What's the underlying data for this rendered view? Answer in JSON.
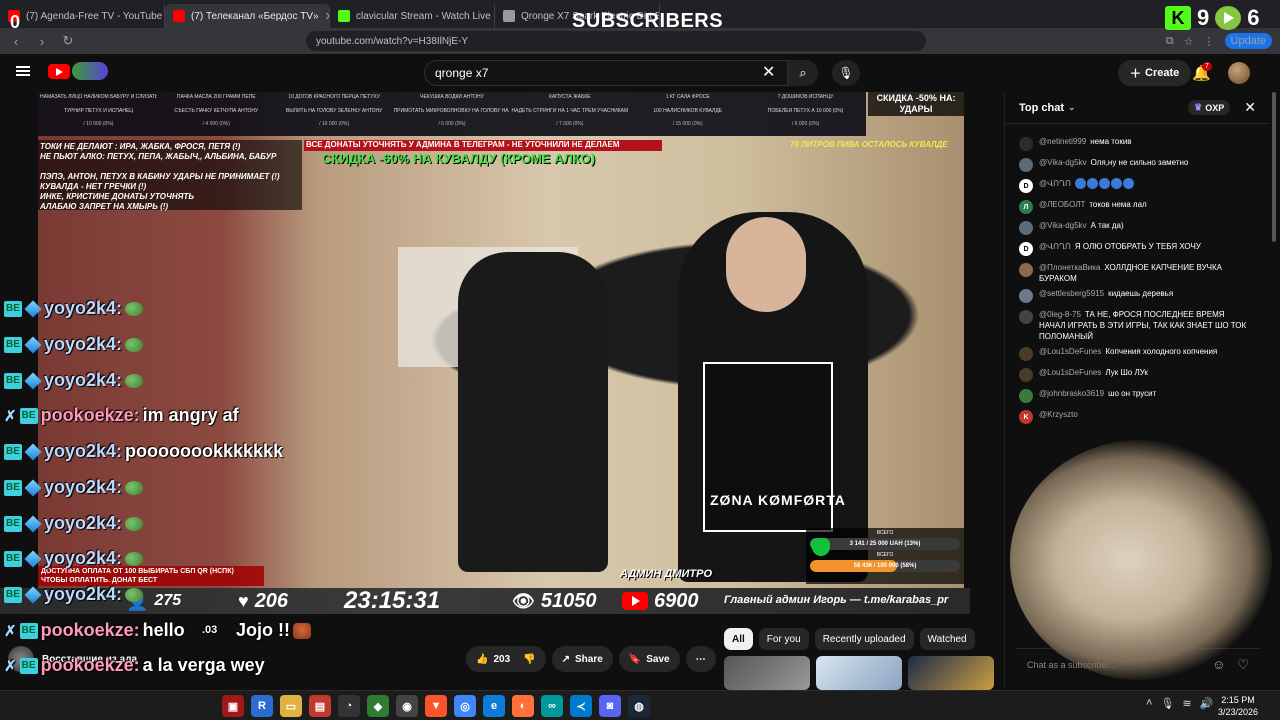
{
  "browser": {
    "tabs": [
      {
        "title": "(7) Agenda-Free TV - YouTube",
        "color": "#ff0000",
        "active": false
      },
      {
        "title": "(7) Телеканал «Бердос TV»",
        "color": "#ff0000",
        "active": true
      },
      {
        "title": "clavicular Stream - Watch Live on Ki",
        "color": "#53fc18",
        "active": false
      },
      {
        "title": "Qronge X7 Spark Electric Dirt Bike |",
        "color": "#999999",
        "active": false
      }
    ],
    "url": "youtube.com/watch?v=H38IlNjE-Y",
    "update_label": "Update"
  },
  "overlay_top": {
    "counter": "0",
    "subscribers_label": "SUBSCRIBERS",
    "kick_count": "9",
    "rumble_count": "6"
  },
  "youtube": {
    "search_query": "qronge x7",
    "create_label": "Create",
    "notifications_count": "7"
  },
  "stream": {
    "donation_items": [
      {
        "label": "НАМАЗАТЬ ЛИЦО НАЛИКОМ БАБУРУ И СЛИЗАТЬ КУВАЛДЕ",
        "price": "/ 10 000 (0%)"
      },
      {
        "label": "ПАЧКА МАСЛА 200 ГРАММ ПЕПЕ",
        "price": "/ 4 000 (0%)"
      },
      {
        "label": "10 ДОГОВ КРАСНОГО ПЕРЦА ПЕТУХУ",
        "price": "/ 10 000 (0%)"
      },
      {
        "label": "ЧЕКУШКА ВОДКИ АНТОНУ",
        "price": "/ 5 000 (0%)"
      },
      {
        "label": "КАПУСТА ЖАБКЕ",
        "price": "/ 7 000 (0%)"
      },
      {
        "label": "1 КГ САЛА ФРОСЕ",
        "price": "/ 15 000 (0%)"
      },
      {
        "label": "7 ДОШИКОВ ИСПАНЦУ",
        "price": "/ 6 000 (0%)"
      },
      {
        "label": "ТУРНИР ПЕТУХ И ИСПАНЕЦ",
        "price": "/ 5 000 (0%)"
      },
      {
        "label": "СЪЕСТЬ ПАЧКУ КЕТЧУПА АНТОНУ",
        "price": "/ 2 000 (0%)"
      },
      {
        "label": "ВЫЛИТЬ НА ГОЛОВУ ЗЕЛЕНКУ АНТОНУ",
        "price": "/ 2 000 (0%)"
      },
      {
        "label": "ПРИМОТАТЬ МИКРОВОЛНОВКУ НА ГОЛОВУ НА 10 МИН КУВАЛДЕ",
        "price": "/ 10 000 (0%)"
      },
      {
        "label": "НАДЕТЬ СТРИНГИ НА 1 ЧАС ТРЕМ УЧАСНИКАМ",
        "price": "/ 6 000 (0%)"
      },
      {
        "label": "100 НАЛИСНИКОВ КУВАЛДЕ",
        "price": "/ 30 000 (0%)"
      },
      {
        "label": "ПОБЕЛЕЙ ПЕТУХ А 10 000 (0%)",
        "price": "/ 2 000 (0%)"
      }
    ],
    "discount_strikes": "СКИДКА -50% НА: УДАРЫ",
    "rules_lines": [
      "ТОКИ НЕ ДЕЛАЮТ : ИРА, ЖАБКА, ФРОСЯ, ПЕТЯ (!)",
      "НЕ ПЬЮТ АЛКО: ПЕТУХ, ПЕПА, ЖАБЫЧ,, АЛЬБИНА, БАБУР",
      "",
      "ПЭПЭ, АНТОН, ПЕТУХ В КАБИНУ УДАРЫ НЕ ПРИНИМАЕТ (!)",
      "КУВАЛДА - НЕТ ГРЕЧКИ (!)",
      "ИНКЕ, КРИСТИНЕ ДОНАТЫ УТОЧНЯТЬ",
      "АЛАБАЮ ЗАПРЕТ НА ХМЫРЬ (!)"
    ],
    "red_banner": "ВСЕ ДОНАТЫ УТОЧНЯТЬ У АДМИНА В ТЕЛЕГРАМ - НЕ УТОЧНИЛИ НЕ ДЕЛАЕМ",
    "green_banner": "СКИДКА -60% НА КУВАЛДУ (КРОМЕ АЛКО)",
    "beer_left": "78 ЛИТРОВ ПИВА ОСТАЛОСЬ КУВАЛДЕ",
    "shirt_brand": "ZØNA KØMFØRTA",
    "admin_label": "АДМИН ДМИТРО",
    "goals": [
      {
        "title": "ВСЕГО",
        "text": "3 141 / 25 000 UAH (13%)",
        "fraction": 0.13,
        "color": "#22b14c"
      },
      {
        "title": "ВСЕГО",
        "text": "58 436 / 100 000 (58%)",
        "fraction": 0.58,
        "color": "#f0932b"
      }
    ],
    "donate_banner": "ДОСТУПНА ОПЛАТА ОТ 100 ВЫБИРАТЬ СБП QR (НСПК) ЧТОБЫ ОПЛАТИТЬ. ДОНАТ БЕСТ",
    "stats": {
      "viewers_small": "275",
      "likes": "206",
      "timer": "23:15:31",
      "views": "51050",
      "yt_subs": "6900",
      "ticker": "Главный админ Игорь — t.me/karabas_pr"
    }
  },
  "overlay_chat": [
    {
      "user": "yoyo2k4:",
      "text": "",
      "style": "blue",
      "emote": "pepe"
    },
    {
      "user": "yoyo2k4:",
      "text": "",
      "style": "blue",
      "emote": "pepe"
    },
    {
      "user": "yoyo2k4:",
      "text": "",
      "style": "blue",
      "emote": "pepe"
    },
    {
      "user": "pookoekze:",
      "text": "im angry af",
      "style": "pink",
      "emote": ""
    },
    {
      "user": "yoyo2k4:",
      "text": "poooooookkkkkkk",
      "style": "blue",
      "emote": ""
    },
    {
      "user": "yoyo2k4:",
      "text": "",
      "style": "blue",
      "emote": "pepe"
    },
    {
      "user": "yoyo2k4:",
      "text": "",
      "style": "blue",
      "emote": "pepe"
    },
    {
      "user": "yoyo2k4:",
      "text": "",
      "style": "blue",
      "emote": "pepe"
    },
    {
      "user": "yoyo2k4:",
      "text": "",
      "style": "blue",
      "emote": "pepe"
    },
    {
      "user": "pookoekze:",
      "text": "hello",
      "style": "pink",
      "emote": ""
    },
    {
      "user": "pookoekze:",
      "text": "a la verga wey",
      "style": "pink",
      "emote": ""
    },
    {
      "user": "pookoekze:",
      "text": "",
      "style": "pink",
      "emote": ""
    }
  ],
  "overlay_extra": {
    "jojo": "Jojo !!",
    "amount": ".03"
  },
  "below_video": {
    "channel_name": "Восставшие из ада",
    "like_count": "203",
    "share_label": "Share",
    "save_label": "Save",
    "chips": [
      "All",
      "For you",
      "Recently uploaded",
      "Watched"
    ]
  },
  "live_chat": {
    "title": "Top chat",
    "oxp_label": "OXP",
    "messages": [
      {
        "author": "@netineti999",
        "text": "нема токив",
        "avatar_color": "#2b2b2b",
        "initial": ""
      },
      {
        "author": "@Vika-dg5kv",
        "text": "Оля,ну не сильно заметно",
        "avatar_color": "#5a6b7a",
        "initial": ""
      },
      {
        "author": "@ՎՈՂՈ",
        "text": "",
        "avatar_color": "#ffffff",
        "initial": "D"
      },
      {
        "author": "@ЛЕОБОЛТ",
        "text": "токов нема лал",
        "avatar_color": "#2e7d4f",
        "initial": "Л"
      },
      {
        "author": "@Vika-dg5kv",
        "text": "А так да)",
        "avatar_color": "#5a6b7a",
        "initial": ""
      },
      {
        "author": "@ՎՈՂՈ",
        "text": "Я ОЛЮ ОТОБРАТЬ У ТЕБЯ ХОЧУ",
        "avatar_color": "#ffffff",
        "initial": "D"
      },
      {
        "author": "@ПлонеткаВика",
        "text": "ХОЛЛДНОЕ КАПЧЕНИЕ ВУЧКА БУРАКОМ",
        "avatar_color": "#8a6a4a",
        "initial": ""
      },
      {
        "author": "@settlesberg5915",
        "text": "кидаешь деревья",
        "avatar_color": "#6a7a8a",
        "initial": ""
      },
      {
        "author": "@0leg-8-75",
        "text": "ТА НЕ, ФРОСЯ ПОСЛЕДНЕЕ ВРЕМЯ НАЧАЛ ИГРАТЬ В ЭТИ ИГРЫ, ТАК КАК ЗНАЕТ ШО ТОК ПОЛОМАНЫЙ",
        "avatar_color": "#444444",
        "initial": ""
      },
      {
        "author": "@Lou1sDeFunes",
        "text": "Копчения холодного копчения",
        "avatar_color": "#4a3a2a",
        "initial": ""
      },
      {
        "author": "@Lou1sDeFunes",
        "text": "Лук Шо ЛУк",
        "avatar_color": "#4a3a2a",
        "initial": ""
      },
      {
        "author": "@johnbrasko3619",
        "text": "шо он трусит",
        "avatar_color": "#3a7a3a",
        "initial": ""
      },
      {
        "author": "@Krzyszto",
        "text": "",
        "avatar_color": "#c0392b",
        "initial": "K"
      }
    ],
    "input_placeholder": "Chat as a subscriber..."
  },
  "taskbar": {
    "time": "2:15 PM",
    "date": "3/23/2026"
  }
}
